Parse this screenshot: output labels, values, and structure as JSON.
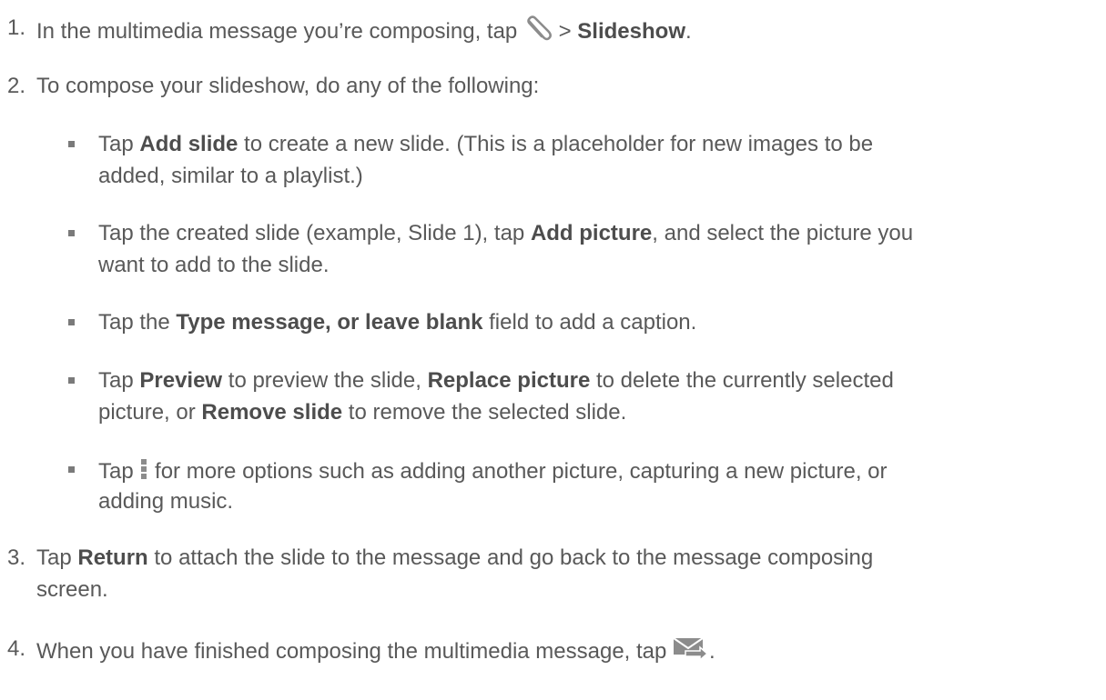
{
  "steps": [
    {
      "number": "1.",
      "parts": [
        "In the multimedia message you’re composing, tap ",
        " > ",
        "Slideshow",
        "."
      ]
    },
    {
      "number": "2.",
      "text": "To compose your slideshow, do any of the following:",
      "bullets": [
        {
          "lines": [
            [
              "Tap ",
              "Add slide",
              " to create a new slide. (This is a placeholder for new images to be"
            ],
            [
              "added, similar to a playlist.)"
            ]
          ]
        },
        {
          "lines": [
            [
              "Tap the created slide (example, Slide 1), tap ",
              "Add picture",
              ", and select the picture you"
            ],
            [
              "want to add to the slide."
            ]
          ]
        },
        {
          "lines": [
            [
              "Tap the ",
              "Type message, or leave blank",
              " field to add a caption."
            ]
          ]
        },
        {
          "lines": [
            [
              "Tap ",
              "Preview",
              " to preview the slide, ",
              "Replace picture",
              " to delete the currently selected"
            ],
            [
              "picture, or ",
              "Remove slide",
              " to remove the selected slide."
            ]
          ]
        },
        {
          "lines": [
            [
              " Tap ",
              " for more options such as adding another picture, capturing a new picture, or"
            ],
            [
              "adding music."
            ]
          ]
        }
      ]
    },
    {
      "number": "3.",
      "lines": [
        [
          "Tap ",
          "Return",
          " to attach the slide to the message and go back to the message composing"
        ],
        [
          "screen."
        ]
      ]
    },
    {
      "number": "4.",
      "parts": [
        "When you have finished composing the multimedia message, tap ",
        "."
      ]
    }
  ],
  "icons": {
    "attach": "paperclip-icon",
    "menu": "menu-icon",
    "send": "send-mms-icon"
  },
  "colors": {
    "text": "#595959",
    "icon": "#8c8c8c"
  }
}
